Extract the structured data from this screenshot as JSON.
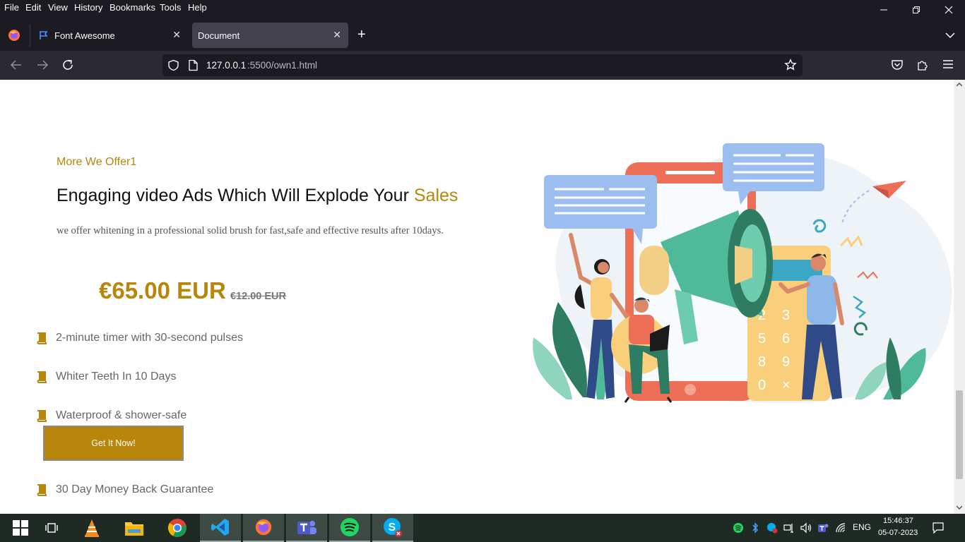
{
  "menu": [
    "File",
    "Edit",
    "View",
    "History",
    "Bookmarks",
    "Tools",
    "Help"
  ],
  "tabs": [
    {
      "title": "Font Awesome",
      "active": false
    },
    {
      "title": "Document",
      "active": true
    }
  ],
  "url": {
    "host": "127.0.0.1",
    "rest": ":5500/own1.html"
  },
  "page": {
    "eyebrow": "More We Offer1",
    "headline": "Engaging video Ads Which Will Explode Your",
    "headline_accent": "Sales",
    "description": "we offer whitening in a professional solid brush for fast,safe and effective results after 10days.",
    "price": "€65.00 EUR",
    "old_price": "€12.00 EUR",
    "features": [
      "2-minute timer with 30-second pulses",
      "Whiter Teeth In 10 Days",
      "Waterproof & shower-safe",
      "30 Day Money Back Guarantee"
    ],
    "cta": "Get It Now!",
    "illustration_numbers": [
      "2",
      "3",
      "5",
      "6",
      "8",
      "9",
      "0",
      "×"
    ]
  },
  "taskbar": {
    "language": "ENG",
    "time": "15:46:37",
    "date": "05-07-2023"
  },
  "colors": {
    "accent": "#b8860b",
    "browser_bg": "#1c1b22"
  }
}
